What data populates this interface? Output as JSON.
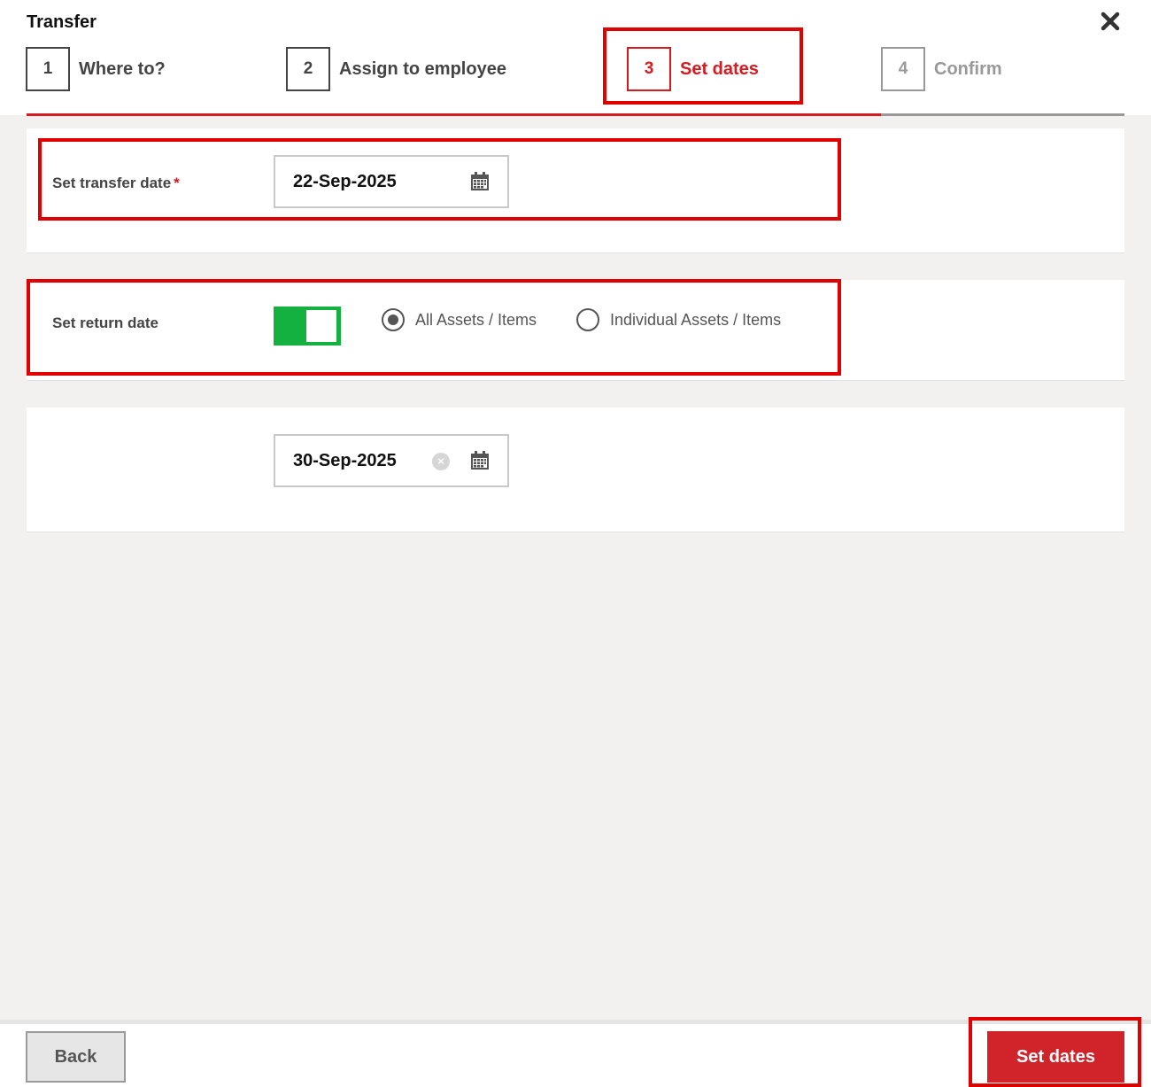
{
  "window": {
    "title": "Transfer"
  },
  "steps": [
    {
      "number": "1",
      "label": "Where to?",
      "state": "done"
    },
    {
      "number": "2",
      "label": "Assign to employee",
      "state": "done"
    },
    {
      "number": "3",
      "label": "Set dates",
      "state": "active"
    },
    {
      "number": "4",
      "label": "Confirm",
      "state": "disabled"
    }
  ],
  "progress": {
    "completed_steps": 3,
    "total_steps": 4
  },
  "transfer": {
    "label": "Set transfer date",
    "required_mark": "*",
    "value": "22-Sep-2025"
  },
  "return": {
    "label": "Set return date",
    "toggle_on": true,
    "options": [
      "All Assets / Items",
      "Individual Assets / Items"
    ],
    "selected_option": "All Assets / Items",
    "date_value": "30-Sep-2025"
  },
  "footer": {
    "back_label": "Back",
    "submit_label": "Set dates"
  },
  "colors": {
    "accent": "#d71920",
    "toggle_on": "#14b141",
    "highlight": "#e00000"
  },
  "icons": {
    "close": "close-icon",
    "calendar": "calendar-icon",
    "clear": "clear-icon"
  }
}
